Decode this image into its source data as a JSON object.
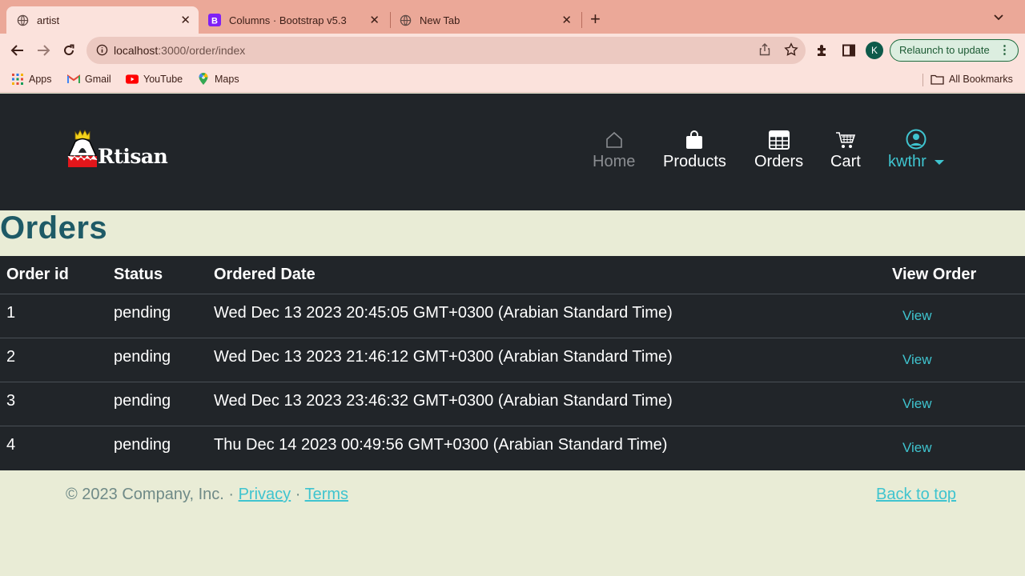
{
  "browser": {
    "tabs": [
      {
        "title": "artist",
        "active": true
      },
      {
        "title": "Columns · Bootstrap v5.3",
        "active": false
      },
      {
        "title": "New Tab",
        "active": false
      }
    ],
    "url_host": "localhost",
    "url_path": ":3000/order/index",
    "profile_initial": "K",
    "relaunch_label": "Relaunch to update",
    "bookmarks": [
      "Apps",
      "Gmail",
      "YouTube",
      "Maps"
    ],
    "all_bookmarks_label": "All Bookmarks"
  },
  "site": {
    "logo_text": "Rtisan",
    "nav": {
      "home": "Home",
      "products": "Products",
      "orders": "Orders",
      "cart": "Cart",
      "user": "kwthr"
    }
  },
  "main": {
    "title": "Orders",
    "columns": [
      "Order id",
      "Status",
      "Ordered Date",
      "View Order"
    ],
    "rows": [
      {
        "id": "1",
        "status": "pending",
        "date": "Wed Dec 13 2023 20:45:05 GMT+0300 (Arabian Standard Time)",
        "action": "View"
      },
      {
        "id": "2",
        "status": "pending",
        "date": "Wed Dec 13 2023 21:46:12 GMT+0300 (Arabian Standard Time)",
        "action": "View"
      },
      {
        "id": "3",
        "status": "pending",
        "date": "Wed Dec 13 2023 23:46:32 GMT+0300 (Arabian Standard Time)",
        "action": "View"
      },
      {
        "id": "4",
        "status": "pending",
        "date": "Thu Dec 14 2023 00:49:56 GMT+0300 (Arabian Standard Time)",
        "action": "View"
      }
    ]
  },
  "footer": {
    "copyright": "© 2023 Company, Inc. · ",
    "privacy": "Privacy",
    "separator": " · ",
    "terms": "Terms",
    "back_to_top": "Back to top"
  },
  "colors": {
    "accent": "#3fc4cf",
    "header_bg": "#212529",
    "page_bg": "#e9ecd6",
    "title": "#1e5a66"
  }
}
